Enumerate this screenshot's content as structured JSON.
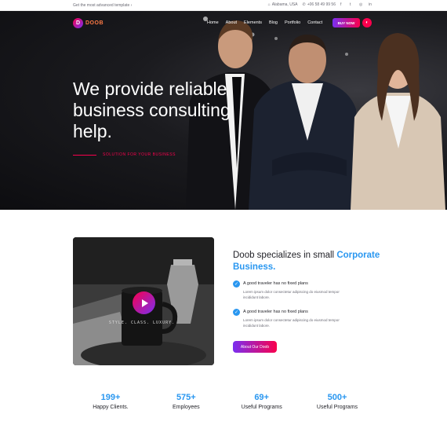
{
  "topbar": {
    "promo": "Get the most advanced template ›",
    "location": "Alabama, USA",
    "phone": "+06 58 49 99 56",
    "social": [
      {
        "icon": "facebook-icon",
        "glyph": "f"
      },
      {
        "icon": "twitter-icon",
        "glyph": "t"
      },
      {
        "icon": "instagram-icon",
        "glyph": "◎"
      },
      {
        "icon": "linkedin-icon",
        "glyph": "in"
      }
    ]
  },
  "nav": {
    "logo_letter": "D",
    "logo_text": "DOOB",
    "items": [
      "Home",
      "About",
      "Elements",
      "Blog",
      "Portfolio",
      "Contact"
    ],
    "buy_label": "BUY NOW",
    "accent": "#f9004d"
  },
  "hero": {
    "title": "We provide reliable business consulting help.",
    "tagline": "SOLUTION FOR YOUR BUSINESS"
  },
  "about": {
    "title_start": "Doob specializes in small ",
    "title_highlight": "Corporate Business.",
    "mug_text": "STYLE. CLASS. LUXURY.",
    "features": [
      {
        "title": "A good traveler has no fixed plans",
        "desc": "Lorem ipsum dolor consectetur adipiscing do eiusmod tempor incididunt labore."
      },
      {
        "title": "A good traveler has no fixed plans",
        "desc": "Lorem ipsum dolor consectetur adipiscing do eiusmod tempor incididunt labore."
      }
    ],
    "button_label": "About Our Doob"
  },
  "stats": [
    {
      "num": "199+",
      "label": "Happy Clients."
    },
    {
      "num": "575+",
      "label": "Employees"
    },
    {
      "num": "69+",
      "label": "Useful Programs"
    },
    {
      "num": "500+",
      "label": "Useful Programs"
    }
  ]
}
